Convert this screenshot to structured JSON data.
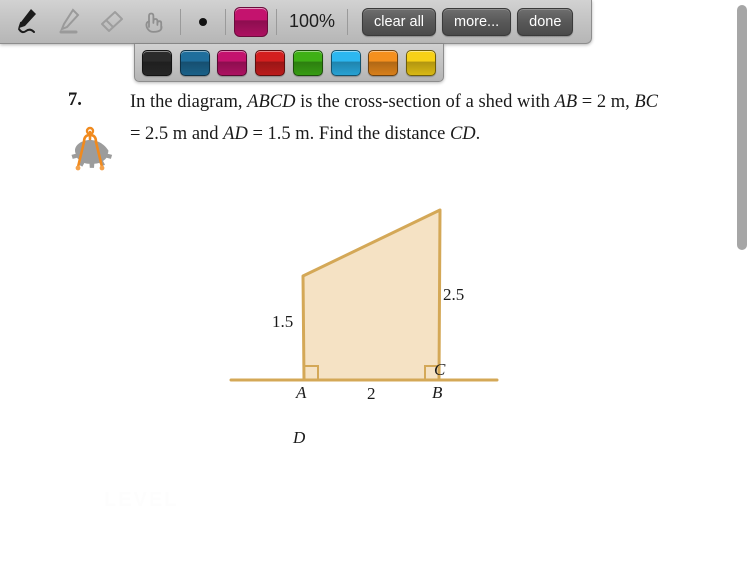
{
  "toolbar": {
    "tools": [
      {
        "name": "pen-tool",
        "icon": "pen-icon",
        "active": true
      },
      {
        "name": "highlighter-tool",
        "icon": "pencil-icon",
        "active": false
      },
      {
        "name": "eraser-tool",
        "icon": "eraser-icon",
        "active": false
      },
      {
        "name": "pan-tool",
        "icon": "hand-icon",
        "active": false
      }
    ],
    "brush_size_label": "brush-size-dot",
    "current_color": "#c4136e",
    "opacity": "100%",
    "buttons": [
      {
        "name": "clear-all-button",
        "label": "clear all"
      },
      {
        "name": "more-button",
        "label": "more..."
      },
      {
        "name": "done-button",
        "label": "done"
      }
    ]
  },
  "palette": {
    "colors": [
      {
        "name": "swatch-black",
        "hex": "#2b2b2b"
      },
      {
        "name": "swatch-blue",
        "hex": "#1f6e9c"
      },
      {
        "name": "swatch-magenta",
        "hex": "#c4136e"
      },
      {
        "name": "swatch-red",
        "hex": "#d41f1f"
      },
      {
        "name": "swatch-green",
        "hex": "#3fb016"
      },
      {
        "name": "swatch-cyan",
        "hex": "#2cb7f0"
      },
      {
        "name": "swatch-orange",
        "hex": "#f5901e"
      },
      {
        "name": "swatch-yellow",
        "hex": "#f7d117"
      }
    ]
  },
  "question": {
    "number": "7.",
    "line1_a": "In the diagram, ",
    "line1_b": "ABCD",
    "line1_c": " is the cross-section of a",
    "line2_a": "shed with ",
    "line2_b": "AB",
    "line2_c": " = 2 m, ",
    "line2_d": "BC",
    "line2_e": " = 2.5 m and ",
    "line2_f": "AD",
    "line2_g": " = 1.5 m.",
    "line3_a": "Find the distance ",
    "line3_b": "CD",
    "line3_c": ".",
    "tool_icon": "compass-gear-icon"
  },
  "diagram": {
    "vertex_labels": {
      "A": "A",
      "B": "B",
      "C": "C",
      "D": "D"
    },
    "measurements": {
      "AD": "1.5",
      "BC": "2.5",
      "AB": "2"
    },
    "fill_color": "#f5e2c4",
    "stroke_color": "#d4a857",
    "right_angles": [
      "A",
      "B"
    ]
  },
  "watermark": {
    "text": "LEVEL"
  },
  "scrollbar": {
    "name": "vertical-scrollbar"
  }
}
